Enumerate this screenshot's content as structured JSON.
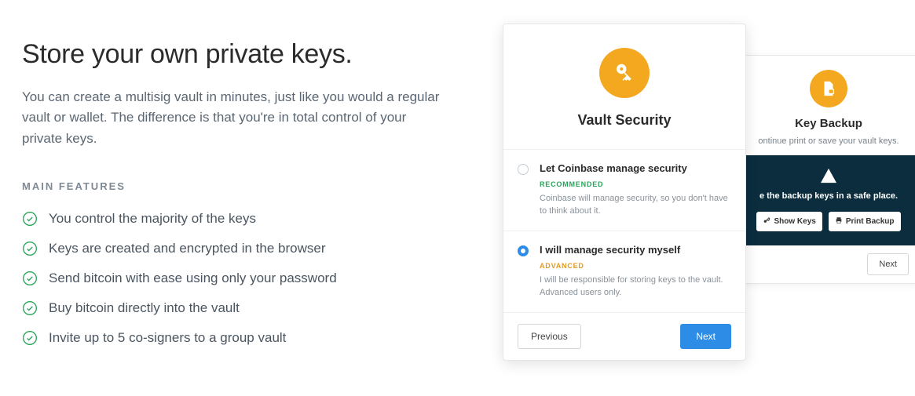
{
  "heading": "Store your own private keys.",
  "subtext": "You can create a multisig vault in minutes, just like you would a regular vault or wallet. The difference is that you're in total control of your private keys.",
  "features_label": "MAIN FEATURES",
  "features": [
    "You control the majority of the keys",
    "Keys are created and encrypted in the browser",
    "Send bitcoin with ease using only your password",
    "Buy bitcoin directly into the vault",
    "Invite up to 5 co-signers to a group vault"
  ],
  "vault": {
    "title": "Vault Security",
    "option1": {
      "title": "Let Coinbase manage security",
      "badge": "RECOMMENDED",
      "desc": "Coinbase will manage security, so you don't have to think about it."
    },
    "option2": {
      "title": "I will manage security myself",
      "badge": "ADVANCED",
      "desc": "I will be responsible for storing keys to the vault. Advanced users only."
    },
    "prev": "Previous",
    "next": "Next"
  },
  "backup": {
    "title": "Key Backup",
    "sub": "ontinue print or save your vault keys.",
    "dark_text": "e the backup keys in a safe place.",
    "show_keys": "Show Keys",
    "print_backup": "Print Backup",
    "next": "Next"
  }
}
